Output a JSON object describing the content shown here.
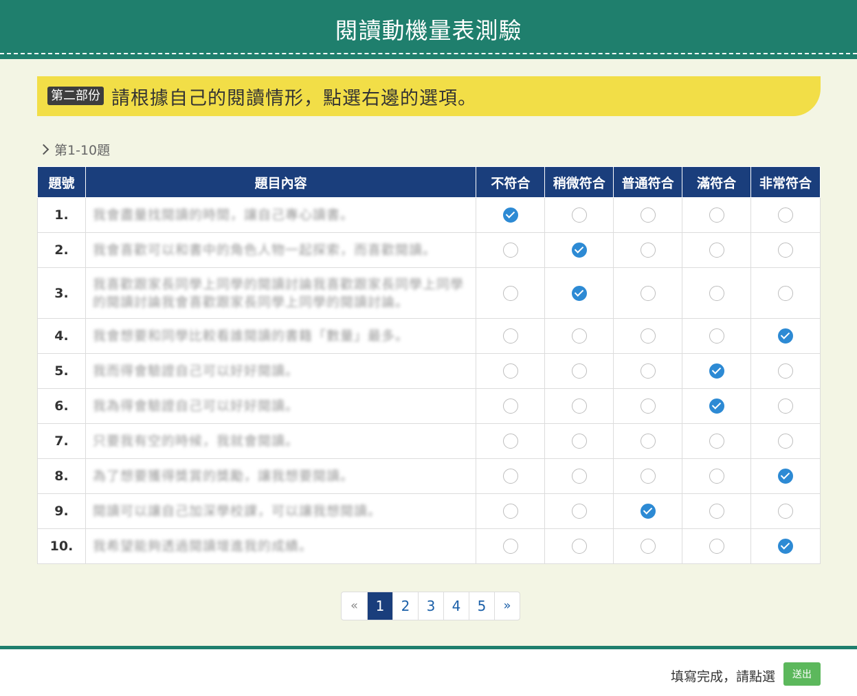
{
  "header": {
    "title": "閱讀動機量表測驗"
  },
  "banner": {
    "tag": "第二部份",
    "instruction": "請根據自己的閱讀情形，點選右邊的選項。"
  },
  "section": {
    "label": "第1-10題"
  },
  "table": {
    "columns": [
      "題號",
      "題目內容",
      "不符合",
      "稍微符合",
      "普通符合",
      "滿符合",
      "非常符合"
    ],
    "rows": [
      {
        "num": "1.",
        "text": "我會盡量找閱讀的時間，讓自己專心讀書。",
        "selected": 0
      },
      {
        "num": "2.",
        "text": "我會喜歡可以和書中的角色人物一起探索，而喜歡閱讀。",
        "selected": 1
      },
      {
        "num": "3.",
        "text": "我喜歡跟家長同學上同學的閱讀討論我喜歡跟家長同學上同學的閱讀討論我會喜歡跟家長同學上同學的閱讀討論。",
        "selected": 1
      },
      {
        "num": "4.",
        "text": "我會想要和同學比較看誰閱讀的書籍「數量」最多。",
        "selected": 4
      },
      {
        "num": "5.",
        "text": "我而得會驗證自己可以好好閱讀。",
        "selected": 3
      },
      {
        "num": "6.",
        "text": "我為得會驗證自己可以好好閱讀。",
        "selected": 3
      },
      {
        "num": "7.",
        "text": "只要我有空的時候，我就會閱讀。",
        "selected": -1
      },
      {
        "num": "8.",
        "text": "為了想要獲得獎賞的獎勵，讓我想要閱讀。",
        "selected": 4
      },
      {
        "num": "9.",
        "text": "閱讀可以讓自己加深學校課，可以讓我想閱讀。",
        "selected": 2
      },
      {
        "num": "10.",
        "text": "我希望能夠透過閱讀增進我的成績。",
        "selected": 4
      }
    ]
  },
  "pager": {
    "prev": "«",
    "pages": [
      "1",
      "2",
      "3",
      "4",
      "5"
    ],
    "current": "1",
    "next": "»"
  },
  "footer": {
    "done_text": "填寫完成，請點選",
    "submit_label": "送出"
  },
  "colors": {
    "header": "#1f7f6d",
    "banner": "#f2de47",
    "table_header": "#1a3e7c",
    "radio_checked": "#2d8ad4",
    "submit": "#5cb85c"
  }
}
